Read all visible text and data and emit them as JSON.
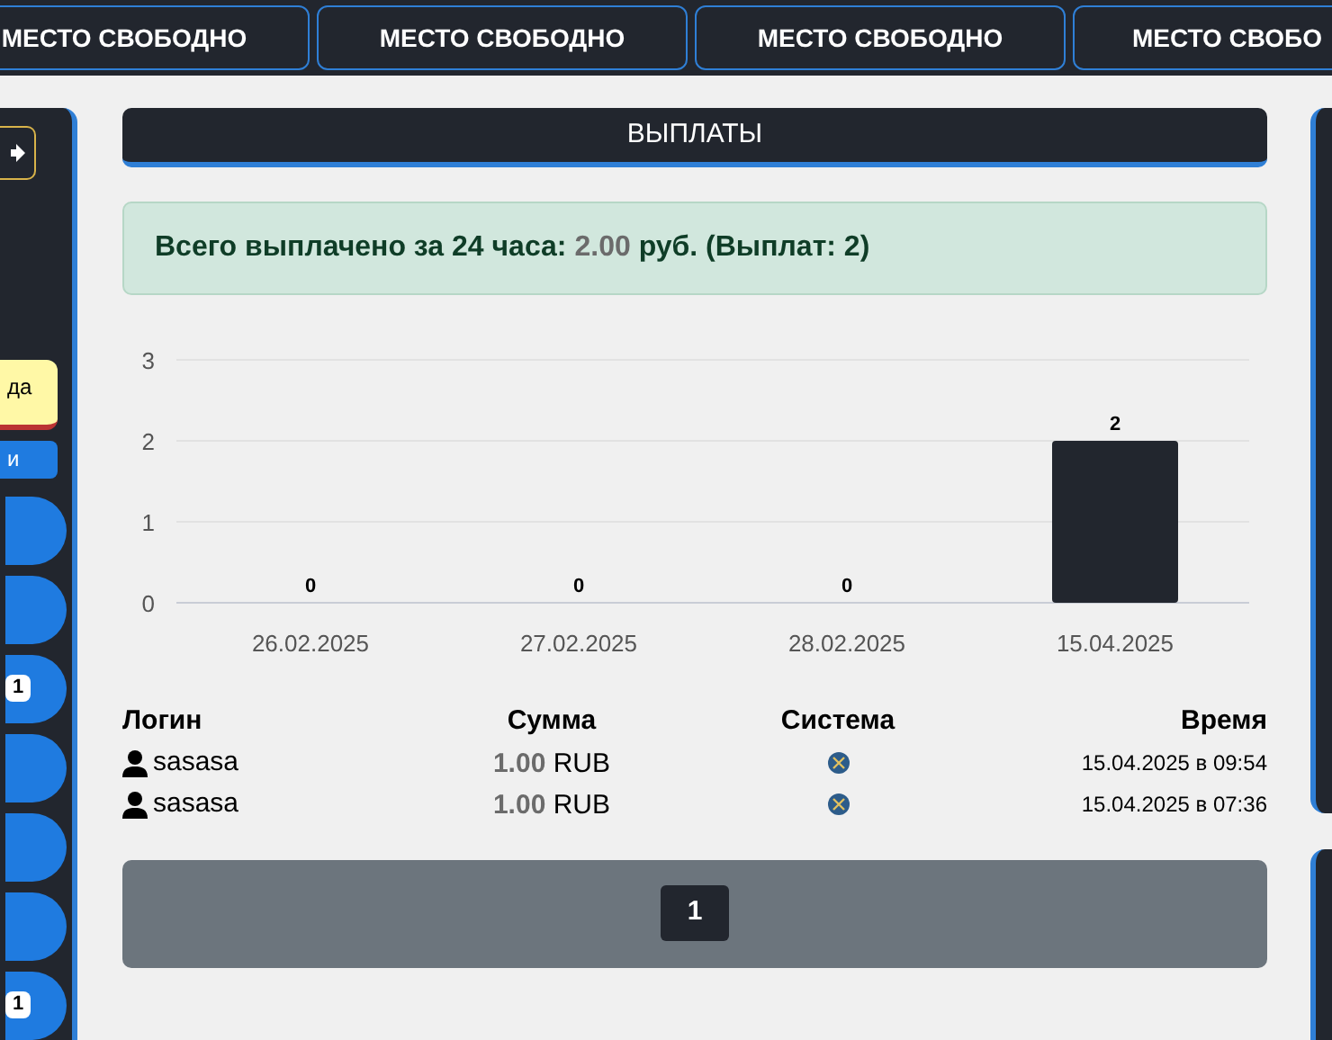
{
  "top_slots": [
    {
      "label": "МЕСТО СВОБОДНО"
    },
    {
      "label": "МЕСТО СВОБОДНО"
    },
    {
      "label": "МЕСТО СВОБОДНО"
    },
    {
      "label": "МЕСТО СВОБО"
    }
  ],
  "sidebar": {
    "note": "да",
    "action": "и",
    "items": [
      {
        "kind": "plain"
      },
      {
        "kind": "plain"
      },
      {
        "kind": "badge",
        "badge": "1"
      },
      {
        "kind": "plain"
      },
      {
        "kind": "plain"
      },
      {
        "kind": "plain"
      },
      {
        "kind": "badge",
        "badge": "1"
      }
    ]
  },
  "section_title": "ВЫПЛАТЫ",
  "summary": {
    "label": "Всего выплачено за 24 часа:",
    "amount": "2.00",
    "suffix": "руб. (Выплат: 2)"
  },
  "chart_data": {
    "type": "bar",
    "categories": [
      "26.02.2025",
      "27.02.2025",
      "28.02.2025",
      "15.04.2025"
    ],
    "series": [
      {
        "color": "#22262e",
        "values": [
          0,
          0,
          0,
          2
        ]
      }
    ],
    "ylim": [
      0,
      3
    ],
    "yticks": [
      0,
      1,
      2,
      3
    ],
    "data_labels": true
  },
  "table": {
    "columns": [
      "Логин",
      "Сумма",
      "Система",
      "Время"
    ],
    "rows": [
      {
        "login": "sasasa",
        "amount": "1.00",
        "currency": "RUB",
        "time": "15.04.2025 в 09:54"
      },
      {
        "login": "sasasa",
        "amount": "1.00",
        "currency": "RUB",
        "time": "15.04.2025 в 07:36"
      }
    ]
  },
  "pagination": [
    {
      "label": "1",
      "selected": true
    }
  ]
}
